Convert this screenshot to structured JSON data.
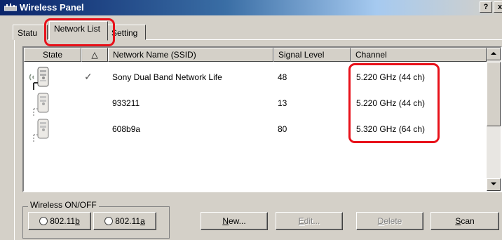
{
  "window": {
    "title": "Wireless Panel",
    "help_label": "?",
    "close_label": "x"
  },
  "tabs": [
    {
      "label": "Status",
      "shown": "Statu"
    },
    {
      "label": "Network List"
    },
    {
      "label": "Setting",
      "shown": "Setting"
    }
  ],
  "list": {
    "columns": [
      "State",
      "",
      "Network Name (SSID)",
      "Signal Level",
      "Channel"
    ],
    "sort_indicator": "△",
    "rows": [
      {
        "connected": true,
        "ssid": "Sony Dual Band Network Life",
        "signal": "48",
        "channel": "5.220 GHz (44 ch)"
      },
      {
        "connected": false,
        "ssid": "933211",
        "signal": "13",
        "channel": "5.220 GHz (44 ch)"
      },
      {
        "connected": false,
        "ssid": "608b9a",
        "signal": "80",
        "channel": "5.320 GHz (64 ch)"
      }
    ],
    "check_glyph": "✓"
  },
  "wireless_toggle": {
    "group_label": "Wireless ON/OFF",
    "btn_b_pre": "802.11",
    "btn_b_key": "b",
    "btn_a_pre": "802.11",
    "btn_a_key": "a"
  },
  "actions": {
    "new_key": "N",
    "new_rest": "ew...",
    "edit_key": "E",
    "edit_rest": "dit...",
    "delete_key": "D",
    "delete_rest": "elete",
    "scan_key": "S",
    "scan_rest": "can"
  },
  "colors": {
    "highlight": "#e8111a",
    "title_bar": "#0a246a",
    "face": "#d4d0c8"
  }
}
